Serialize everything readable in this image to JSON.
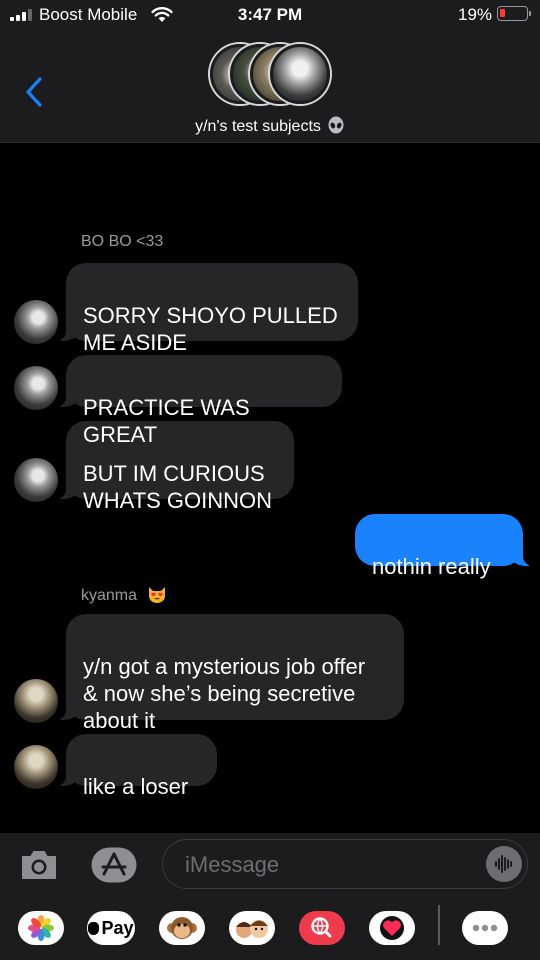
{
  "status_bar": {
    "carrier": "Boost Mobile",
    "time": "3:47 PM",
    "battery_percent": "19%",
    "battery_level": 0.19
  },
  "header": {
    "group_name": "y/n's test subjects",
    "group_emoji": "alien-emoji"
  },
  "messages": [
    {
      "sender": "BO BO <33",
      "direction": "incoming",
      "text": "SORRY SHOYO PULLED\nME ASIDE"
    },
    {
      "direction": "incoming",
      "text": "PRACTICE WAS GREAT"
    },
    {
      "direction": "incoming",
      "text": "BUT IM CURIOUS\nWHATS GOINNON"
    },
    {
      "direction": "outgoing",
      "text": "nothin really"
    },
    {
      "sender": "kyanma",
      "sender_emoji": "heart-eyes-cat-emoji",
      "direction": "incoming",
      "text": "y/n got a mysterious job offer\n& now she’s being secretive\nabout it"
    },
    {
      "direction": "incoming",
      "text": "like a loser"
    }
  ],
  "input": {
    "placeholder": "iMessage"
  },
  "app_drawer": {
    "items": [
      "photos-icon",
      "apple-pay-icon",
      "monkey-memoji-icon",
      "memoji-icon",
      "web-images-icon",
      "digital-touch-icon",
      "more-icon"
    ],
    "apple_pay_label": "Pay"
  },
  "colors": {
    "outgoing_bubble": "#1a82fb",
    "incoming_bubble": "#262629",
    "background": "#000000",
    "accent": "#1a82fb"
  }
}
